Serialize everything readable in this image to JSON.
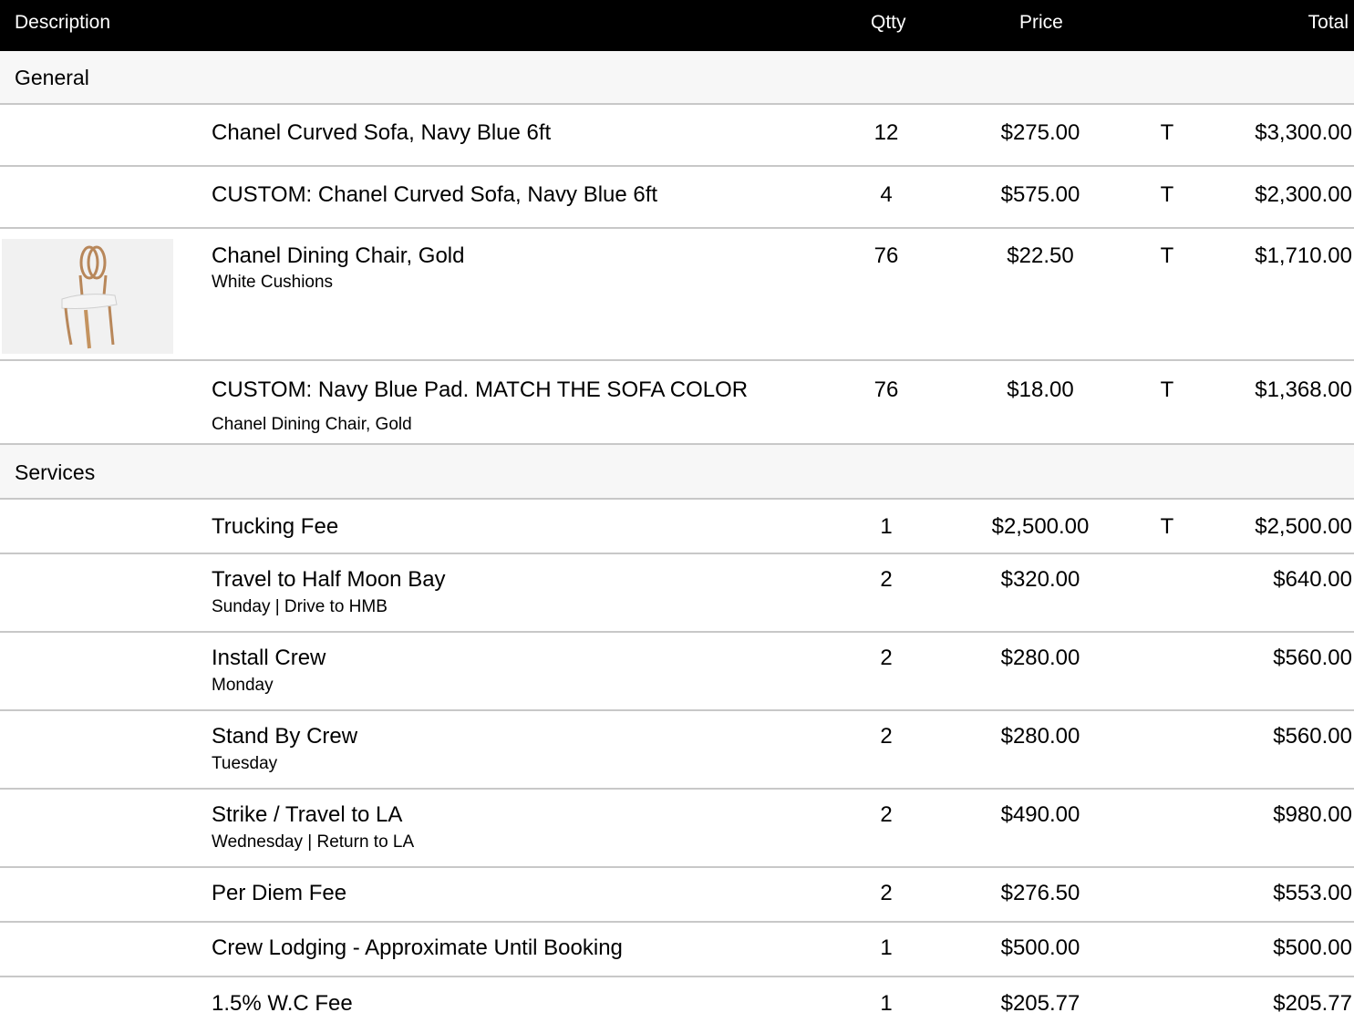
{
  "header": {
    "description": "Description",
    "qty": "Qtty",
    "price": "Price",
    "total": "Total"
  },
  "groups": [
    {
      "name": "General",
      "items": [
        {
          "description": "Chanel Curved Sofa, Navy Blue 6ft",
          "sub": "",
          "qty": "12",
          "price": "$275.00",
          "tax": "T",
          "total": "$3,300.00"
        },
        {
          "description": "CUSTOM: Chanel Curved Sofa, Navy Blue 6ft",
          "sub": "",
          "qty": "4",
          "price": "$575.00",
          "tax": "T",
          "total": "$2,300.00"
        },
        {
          "description": "Chanel Dining Chair, Gold",
          "sub": "White Cushions",
          "qty": "76",
          "price": "$22.50",
          "tax": "T",
          "total": "$1,710.00",
          "image": "gold-dining-chair"
        },
        {
          "description": "CUSTOM: Navy Blue Pad. MATCH THE SOFA COLOR",
          "sub": "Chanel Dining Chair, Gold",
          "qty": "76",
          "price": "$18.00",
          "tax": "T",
          "total": "$1,368.00"
        }
      ]
    },
    {
      "name": "Services",
      "items": [
        {
          "description": "Trucking Fee",
          "sub": "",
          "qty": "1",
          "price": "$2,500.00",
          "tax": "T",
          "total": "$2,500.00"
        },
        {
          "description": "Travel to Half Moon Bay",
          "sub": "Sunday | Drive to HMB",
          "qty": "2",
          "price": "$320.00",
          "tax": "",
          "total": "$640.00"
        },
        {
          "description": "Install Crew",
          "sub": "Monday",
          "qty": "2",
          "price": "$280.00",
          "tax": "",
          "total": "$560.00"
        },
        {
          "description": "Stand By Crew",
          "sub": "Tuesday",
          "qty": "2",
          "price": "$280.00",
          "tax": "",
          "total": "$560.00"
        },
        {
          "description": "Strike / Travel to LA",
          "sub": "Wednesday | Return to LA",
          "qty": "2",
          "price": "$490.00",
          "tax": "",
          "total": "$980.00"
        },
        {
          "description": "Per Diem Fee",
          "sub": "",
          "qty": "2",
          "price": "$276.50",
          "tax": "",
          "total": "$553.00"
        },
        {
          "description": "Crew Lodging - Approximate Until Booking",
          "sub": "",
          "qty": "1",
          "price": "$500.00",
          "tax": "",
          "total": "$500.00"
        },
        {
          "description": "1.5% W.C Fee",
          "sub": "",
          "qty": "1",
          "price": "$205.77",
          "tax": "",
          "total": "$205.77"
        }
      ]
    }
  ]
}
